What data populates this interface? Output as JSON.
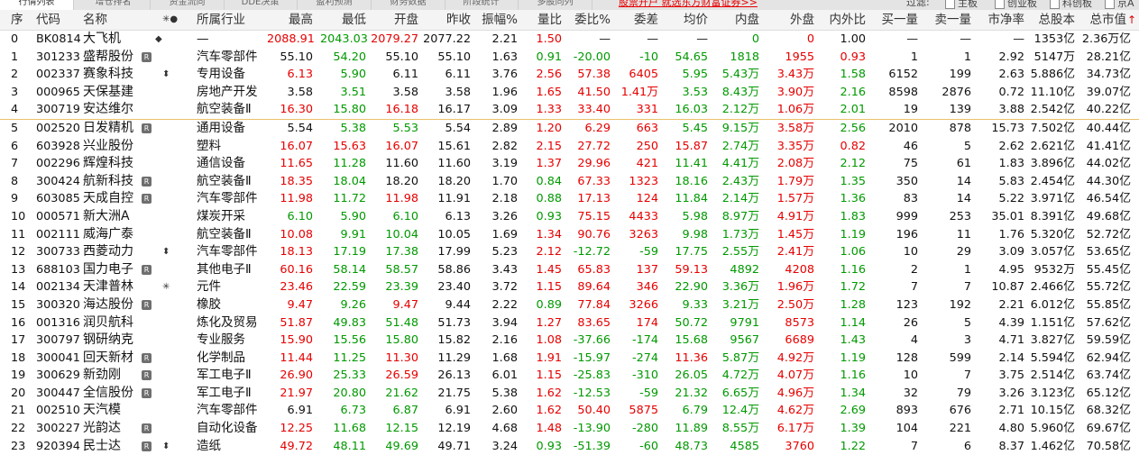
{
  "top_tabs": [
    "行情列表",
    "增仓排名",
    "资金流向",
    "DDE决策",
    "盈利预测",
    "财务数据",
    "阶段统计",
    "多股同列"
  ],
  "promo_link": "股票开户 就选东方财富证券>>",
  "filter": {
    "label": "过滤:",
    "options": [
      {
        "label": "主板",
        "checked": false
      },
      {
        "label": "创业板",
        "checked": false
      },
      {
        "label": "科创板",
        "checked": false
      },
      {
        "label": "京A",
        "checked": false
      }
    ]
  },
  "header": {
    "seq": "序",
    "code": "代码",
    "name": "名称",
    "flags": "✳●",
    "industry": "所属行业",
    "high": "最高",
    "low": "最低",
    "open": "开盘",
    "prev_close": "昨收",
    "amplitude": "振幅%",
    "vol_ratio": "量比",
    "bid_ratio": "委比%",
    "bid_diff": "委差",
    "avg": "均价",
    "inner": "内盘",
    "outer": "外盘",
    "io_ratio": "内外比",
    "buy_vol": "买一量",
    "sell_vol": "卖一量",
    "pb": "市净率",
    "total_shares": "总股本",
    "total_mv": "总市值",
    "sort_indicator": "↑"
  },
  "colors": {
    "up": "#e60000",
    "down": "#009900",
    "neutral": "#111111"
  },
  "rows": [
    {
      "seq": "0",
      "code": "BK0814",
      "name": "大飞机",
      "badge": "",
      "mark": "◆",
      "industry": "—",
      "high": "2088.91",
      "low": "2043.03",
      "open": "2079.27",
      "prev": "2077.22",
      "amp": "2.21",
      "vr": "1.50",
      "br": "—",
      "bd": "—",
      "avg": "—",
      "inner": "0",
      "outer": "0",
      "io": "1.00",
      "buy": "—",
      "sell": "—",
      "pb": "—",
      "shares": "1353亿",
      "mv": "2.36万亿",
      "c": {
        "high": "up",
        "low": "dn",
        "open": "up",
        "vr": "up",
        "inner": "dn",
        "outer": "up",
        "avg": "eq",
        "br": "eq",
        "bd": "eq"
      }
    },
    {
      "seq": "1",
      "code": "301233",
      "name": "盛帮股份",
      "badge": "R",
      "mark": "",
      "industry": "汽车零部件",
      "high": "55.10",
      "low": "54.20",
      "open": "55.10",
      "prev": "55.10",
      "amp": "1.63",
      "vr": "0.91",
      "br": "-20.00",
      "bd": "-10",
      "avg": "54.65",
      "inner": "1818",
      "outer": "1955",
      "io": "0.93",
      "buy": "1",
      "sell": "1",
      "pb": "2.92",
      "shares": "5147万",
      "mv": "28.21亿",
      "c": {
        "high": "eq",
        "low": "dn",
        "open": "eq",
        "vr": "dn",
        "br": "dn",
        "bd": "dn",
        "avg": "dn",
        "inner": "dn",
        "outer": "up",
        "io": "up"
      }
    },
    {
      "seq": "2",
      "code": "002337",
      "name": "赛象科技",
      "badge": "",
      "mark": "⬍",
      "industry": "专用设备",
      "high": "6.13",
      "low": "5.90",
      "open": "6.11",
      "prev": "6.11",
      "amp": "3.76",
      "vr": "2.56",
      "br": "57.38",
      "bd": "6405",
      "avg": "5.95",
      "inner": "5.43万",
      "outer": "3.43万",
      "io": "1.58",
      "buy": "6152",
      "sell": "199",
      "pb": "2.63",
      "shares": "5.886亿",
      "mv": "34.73亿",
      "c": {
        "high": "up",
        "low": "dn",
        "open": "eq",
        "vr": "up",
        "br": "up",
        "bd": "up",
        "avg": "dn",
        "inner": "dn",
        "outer": "up",
        "io": "dn"
      }
    },
    {
      "seq": "3",
      "code": "000965",
      "name": "天保基建",
      "badge": "",
      "mark": "",
      "industry": "房地产开发",
      "high": "3.58",
      "low": "3.51",
      "open": "3.58",
      "prev": "3.58",
      "amp": "1.96",
      "vr": "1.65",
      "br": "41.50",
      "bd": "1.41万",
      "avg": "3.53",
      "inner": "8.43万",
      "outer": "3.90万",
      "io": "2.16",
      "buy": "8598",
      "sell": "2876",
      "pb": "0.72",
      "shares": "11.10亿",
      "mv": "39.07亿",
      "c": {
        "high": "eq",
        "low": "dn",
        "open": "eq",
        "vr": "up",
        "br": "up",
        "bd": "up",
        "avg": "dn",
        "inner": "dn",
        "outer": "up",
        "io": "dn"
      }
    },
    {
      "seq": "4",
      "code": "300719",
      "name": "安达维尔",
      "badge": "",
      "mark": "",
      "industry": "航空装备Ⅱ",
      "high": "16.30",
      "low": "15.80",
      "open": "16.18",
      "prev": "16.17",
      "amp": "3.09",
      "vr": "1.33",
      "br": "33.40",
      "bd": "331",
      "avg": "16.03",
      "inner": "2.12万",
      "outer": "1.06万",
      "io": "2.01",
      "buy": "19",
      "sell": "139",
      "pb": "3.88",
      "shares": "2.542亿",
      "mv": "40.22亿",
      "c": {
        "high": "up",
        "low": "dn",
        "open": "up",
        "vr": "up",
        "br": "up",
        "bd": "up",
        "avg": "dn",
        "inner": "dn",
        "outer": "up",
        "io": "dn"
      }
    },
    {
      "seq": "5",
      "code": "002520",
      "name": "日发精机",
      "badge": "R",
      "mark": "",
      "industry": "通用设备",
      "high": "5.54",
      "low": "5.38",
      "open": "5.53",
      "prev": "5.54",
      "amp": "2.89",
      "vr": "1.20",
      "br": "6.29",
      "bd": "663",
      "avg": "5.45",
      "inner": "9.15万",
      "outer": "3.58万",
      "io": "2.56",
      "buy": "2010",
      "sell": "878",
      "pb": "15.73",
      "shares": "7.502亿",
      "mv": "40.44亿",
      "c": {
        "high": "eq",
        "low": "dn",
        "open": "dn",
        "vr": "up",
        "br": "up",
        "bd": "up",
        "avg": "dn",
        "inner": "dn",
        "outer": "up",
        "io": "dn"
      }
    },
    {
      "seq": "6",
      "code": "603928",
      "name": "兴业股份",
      "badge": "",
      "mark": "",
      "industry": "塑料",
      "high": "16.07",
      "low": "15.63",
      "open": "16.07",
      "prev": "15.61",
      "amp": "2.82",
      "vr": "2.15",
      "br": "27.72",
      "bd": "250",
      "avg": "15.87",
      "inner": "2.74万",
      "outer": "3.35万",
      "io": "0.82",
      "buy": "46",
      "sell": "5",
      "pb": "2.62",
      "shares": "2.621亿",
      "mv": "41.41亿",
      "c": {
        "high": "up",
        "low": "up",
        "open": "up",
        "vr": "up",
        "br": "up",
        "bd": "up",
        "avg": "up",
        "inner": "dn",
        "outer": "up",
        "io": "up"
      }
    },
    {
      "seq": "7",
      "code": "002296",
      "name": "辉煌科技",
      "badge": "",
      "mark": "",
      "industry": "通信设备",
      "high": "11.65",
      "low": "11.28",
      "open": "11.60",
      "prev": "11.60",
      "amp": "3.19",
      "vr": "1.37",
      "br": "29.96",
      "bd": "421",
      "avg": "11.41",
      "inner": "4.41万",
      "outer": "2.08万",
      "io": "2.12",
      "buy": "75",
      "sell": "61",
      "pb": "1.83",
      "shares": "3.896亿",
      "mv": "44.02亿",
      "c": {
        "high": "up",
        "low": "dn",
        "open": "eq",
        "vr": "up",
        "br": "up",
        "bd": "up",
        "avg": "dn",
        "inner": "dn",
        "outer": "up",
        "io": "dn"
      }
    },
    {
      "seq": "8",
      "code": "300424",
      "name": "航新科技",
      "badge": "R",
      "mark": "",
      "industry": "航空装备Ⅱ",
      "high": "18.35",
      "low": "18.04",
      "open": "18.20",
      "prev": "18.20",
      "amp": "1.70",
      "vr": "0.84",
      "br": "67.33",
      "bd": "1323",
      "avg": "18.16",
      "inner": "2.43万",
      "outer": "1.79万",
      "io": "1.35",
      "buy": "350",
      "sell": "14",
      "pb": "5.83",
      "shares": "2.454亿",
      "mv": "44.30亿",
      "c": {
        "high": "up",
        "low": "dn",
        "open": "eq",
        "vr": "dn",
        "br": "up",
        "bd": "up",
        "avg": "dn",
        "inner": "dn",
        "outer": "up",
        "io": "dn"
      }
    },
    {
      "seq": "9",
      "code": "603085",
      "name": "天成自控",
      "badge": "R",
      "mark": "",
      "industry": "汽车零部件",
      "high": "11.98",
      "low": "11.72",
      "open": "11.98",
      "prev": "11.91",
      "amp": "2.18",
      "vr": "0.88",
      "br": "17.13",
      "bd": "124",
      "avg": "11.84",
      "inner": "2.14万",
      "outer": "1.57万",
      "io": "1.36",
      "buy": "83",
      "sell": "14",
      "pb": "5.22",
      "shares": "3.971亿",
      "mv": "46.54亿",
      "c": {
        "high": "up",
        "low": "dn",
        "open": "up",
        "vr": "dn",
        "br": "up",
        "bd": "up",
        "avg": "dn",
        "inner": "dn",
        "outer": "up",
        "io": "dn"
      }
    },
    {
      "seq": "10",
      "code": "000571",
      "name": "新大洲A",
      "badge": "",
      "mark": "",
      "industry": "煤炭开采",
      "high": "6.10",
      "low": "5.90",
      "open": "6.10",
      "prev": "6.13",
      "amp": "3.26",
      "vr": "0.93",
      "br": "75.15",
      "bd": "4433",
      "avg": "5.98",
      "inner": "8.97万",
      "outer": "4.91万",
      "io": "1.83",
      "buy": "999",
      "sell": "253",
      "pb": "35.01",
      "shares": "8.391亿",
      "mv": "49.68亿",
      "c": {
        "high": "dn",
        "low": "dn",
        "open": "dn",
        "vr": "dn",
        "br": "up",
        "bd": "up",
        "avg": "dn",
        "inner": "dn",
        "outer": "up",
        "io": "dn"
      }
    },
    {
      "seq": "11",
      "code": "002111",
      "name": "威海广泰",
      "badge": "",
      "mark": "",
      "industry": "航空装备Ⅱ",
      "high": "10.08",
      "low": "9.91",
      "open": "10.04",
      "prev": "10.05",
      "amp": "1.69",
      "vr": "1.34",
      "br": "90.76",
      "bd": "3263",
      "avg": "9.98",
      "inner": "1.73万",
      "outer": "1.45万",
      "io": "1.19",
      "buy": "196",
      "sell": "11",
      "pb": "1.76",
      "shares": "5.320亿",
      "mv": "52.72亿",
      "c": {
        "high": "up",
        "low": "dn",
        "open": "dn",
        "vr": "up",
        "br": "up",
        "bd": "up",
        "avg": "dn",
        "inner": "dn",
        "outer": "up",
        "io": "dn"
      }
    },
    {
      "seq": "12",
      "code": "300733",
      "name": "西菱动力",
      "badge": "",
      "mark": "⬍",
      "industry": "汽车零部件",
      "high": "18.13",
      "low": "17.19",
      "open": "17.38",
      "prev": "17.99",
      "amp": "5.23",
      "vr": "2.12",
      "br": "-12.72",
      "bd": "-59",
      "avg": "17.75",
      "inner": "2.55万",
      "outer": "2.41万",
      "io": "1.06",
      "buy": "10",
      "sell": "29",
      "pb": "3.09",
      "shares": "3.057亿",
      "mv": "53.65亿",
      "c": {
        "high": "up",
        "low": "dn",
        "open": "dn",
        "vr": "up",
        "br": "dn",
        "bd": "dn",
        "avg": "dn",
        "inner": "dn",
        "outer": "up",
        "io": "dn"
      }
    },
    {
      "seq": "13",
      "code": "688103",
      "name": "国力电子",
      "badge": "R",
      "mark": "",
      "industry": "其他电子Ⅱ",
      "high": "60.16",
      "low": "58.14",
      "open": "58.57",
      "prev": "58.86",
      "amp": "3.43",
      "vr": "1.45",
      "br": "65.83",
      "bd": "137",
      "avg": "59.13",
      "inner": "4892",
      "outer": "4208",
      "io": "1.16",
      "buy": "2",
      "sell": "1",
      "pb": "4.95",
      "shares": "9532万",
      "mv": "55.45亿",
      "c": {
        "high": "up",
        "low": "dn",
        "open": "dn",
        "vr": "up",
        "br": "up",
        "bd": "up",
        "avg": "up",
        "inner": "dn",
        "outer": "up",
        "io": "dn"
      }
    },
    {
      "seq": "14",
      "code": "002134",
      "name": "天津普林",
      "badge": "",
      "mark": "✳",
      "industry": "元件",
      "high": "23.46",
      "low": "22.59",
      "open": "23.39",
      "prev": "23.40",
      "amp": "3.72",
      "vr": "1.15",
      "br": "89.64",
      "bd": "346",
      "avg": "22.90",
      "inner": "3.36万",
      "outer": "1.96万",
      "io": "1.72",
      "buy": "7",
      "sell": "7",
      "pb": "10.87",
      "shares": "2.466亿",
      "mv": "55.72亿",
      "c": {
        "high": "up",
        "low": "dn",
        "open": "dn",
        "vr": "up",
        "br": "up",
        "bd": "up",
        "avg": "dn",
        "inner": "dn",
        "outer": "up",
        "io": "dn"
      }
    },
    {
      "seq": "15",
      "code": "300320",
      "name": "海达股份",
      "badge": "R",
      "mark": "",
      "industry": "橡胶",
      "high": "9.47",
      "low": "9.26",
      "open": "9.47",
      "prev": "9.44",
      "amp": "2.22",
      "vr": "0.89",
      "br": "77.84",
      "bd": "3266",
      "avg": "9.33",
      "inner": "3.21万",
      "outer": "2.50万",
      "io": "1.28",
      "buy": "123",
      "sell": "192",
      "pb": "2.21",
      "shares": "6.012亿",
      "mv": "55.85亿",
      "c": {
        "high": "up",
        "low": "dn",
        "open": "up",
        "vr": "dn",
        "br": "up",
        "bd": "up",
        "avg": "dn",
        "inner": "dn",
        "outer": "up",
        "io": "dn"
      }
    },
    {
      "seq": "16",
      "code": "001316",
      "name": "润贝航科",
      "badge": "",
      "mark": "",
      "industry": "炼化及贸易",
      "high": "51.87",
      "low": "49.83",
      "open": "51.48",
      "prev": "51.73",
      "amp": "3.94",
      "vr": "1.27",
      "br": "83.65",
      "bd": "174",
      "avg": "50.72",
      "inner": "9791",
      "outer": "8573",
      "io": "1.14",
      "buy": "26",
      "sell": "5",
      "pb": "4.39",
      "shares": "1.151亿",
      "mv": "57.62亿",
      "c": {
        "high": "up",
        "low": "dn",
        "open": "dn",
        "vr": "up",
        "br": "up",
        "bd": "up",
        "avg": "dn",
        "inner": "dn",
        "outer": "up",
        "io": "dn"
      }
    },
    {
      "seq": "17",
      "code": "300797",
      "name": "钢研纳克",
      "badge": "",
      "mark": "",
      "industry": "专业服务",
      "high": "15.90",
      "low": "15.56",
      "open": "15.80",
      "prev": "15.82",
      "amp": "2.16",
      "vr": "1.08",
      "br": "-37.66",
      "bd": "-174",
      "avg": "15.68",
      "inner": "9567",
      "outer": "6689",
      "io": "1.43",
      "buy": "4",
      "sell": "3",
      "pb": "4.71",
      "shares": "3.827亿",
      "mv": "59.59亿",
      "c": {
        "high": "up",
        "low": "dn",
        "open": "dn",
        "vr": "up",
        "br": "dn",
        "bd": "dn",
        "avg": "dn",
        "inner": "dn",
        "outer": "up",
        "io": "dn"
      }
    },
    {
      "seq": "18",
      "code": "300041",
      "name": "回天新材",
      "badge": "R",
      "mark": "",
      "industry": "化学制品",
      "high": "11.44",
      "low": "11.25",
      "open": "11.30",
      "prev": "11.29",
      "amp": "1.68",
      "vr": "1.91",
      "br": "-15.97",
      "bd": "-274",
      "avg": "11.36",
      "inner": "5.87万",
      "outer": "4.92万",
      "io": "1.19",
      "buy": "128",
      "sell": "599",
      "pb": "2.14",
      "shares": "5.594亿",
      "mv": "62.94亿",
      "c": {
        "high": "up",
        "low": "dn",
        "open": "up",
        "vr": "up",
        "br": "dn",
        "bd": "dn",
        "avg": "up",
        "inner": "dn",
        "outer": "up",
        "io": "dn"
      }
    },
    {
      "seq": "19",
      "code": "300629",
      "name": "新劲刚",
      "badge": "R",
      "mark": "",
      "industry": "军工电子Ⅱ",
      "high": "26.90",
      "low": "25.33",
      "open": "26.59",
      "prev": "26.13",
      "amp": "6.01",
      "vr": "1.15",
      "br": "-25.83",
      "bd": "-310",
      "avg": "26.05",
      "inner": "4.72万",
      "outer": "4.07万",
      "io": "1.16",
      "buy": "10",
      "sell": "7",
      "pb": "3.75",
      "shares": "2.514亿",
      "mv": "63.74亿",
      "c": {
        "high": "up",
        "low": "dn",
        "open": "up",
        "vr": "up",
        "br": "dn",
        "bd": "dn",
        "avg": "dn",
        "inner": "dn",
        "outer": "up",
        "io": "dn"
      }
    },
    {
      "seq": "20",
      "code": "300447",
      "name": "全信股份",
      "badge": "R",
      "mark": "",
      "industry": "军工电子Ⅱ",
      "high": "21.97",
      "low": "20.80",
      "open": "21.62",
      "prev": "21.75",
      "amp": "5.38",
      "vr": "1.62",
      "br": "-12.53",
      "bd": "-59",
      "avg": "21.32",
      "inner": "6.65万",
      "outer": "4.96万",
      "io": "1.34",
      "buy": "32",
      "sell": "79",
      "pb": "3.26",
      "shares": "3.123亿",
      "mv": "65.12亿",
      "c": {
        "high": "up",
        "low": "dn",
        "open": "dn",
        "vr": "up",
        "br": "dn",
        "bd": "dn",
        "avg": "dn",
        "inner": "dn",
        "outer": "up",
        "io": "dn"
      }
    },
    {
      "seq": "21",
      "code": "002510",
      "name": "天汽模",
      "badge": "",
      "mark": "",
      "industry": "汽车零部件",
      "high": "6.91",
      "low": "6.73",
      "open": "6.87",
      "prev": "6.91",
      "amp": "2.60",
      "vr": "1.62",
      "br": "50.40",
      "bd": "5875",
      "avg": "6.79",
      "inner": "12.4万",
      "outer": "4.62万",
      "io": "2.69",
      "buy": "893",
      "sell": "676",
      "pb": "2.71",
      "shares": "10.15亿",
      "mv": "68.32亿",
      "c": {
        "high": "eq",
        "low": "dn",
        "open": "dn",
        "vr": "up",
        "br": "up",
        "bd": "up",
        "avg": "dn",
        "inner": "dn",
        "outer": "up",
        "io": "dn"
      }
    },
    {
      "seq": "22",
      "code": "300227",
      "name": "光韵达",
      "badge": "R",
      "mark": "",
      "industry": "自动化设备",
      "high": "12.25",
      "low": "11.68",
      "open": "12.15",
      "prev": "12.19",
      "amp": "4.68",
      "vr": "1.48",
      "br": "-13.90",
      "bd": "-280",
      "avg": "11.89",
      "inner": "8.55万",
      "outer": "6.17万",
      "io": "1.39",
      "buy": "104",
      "sell": "221",
      "pb": "4.80",
      "shares": "5.960亿",
      "mv": "69.67亿",
      "c": {
        "high": "up",
        "low": "dn",
        "open": "dn",
        "vr": "up",
        "br": "dn",
        "bd": "dn",
        "avg": "dn",
        "inner": "dn",
        "outer": "up",
        "io": "dn"
      }
    },
    {
      "seq": "23",
      "code": "920394",
      "name": "民士达",
      "badge": "R",
      "mark": "⬍",
      "industry": "造纸",
      "high": "49.72",
      "low": "48.11",
      "open": "49.69",
      "prev": "49.71",
      "amp": "3.24",
      "vr": "0.93",
      "br": "-51.39",
      "bd": "-60",
      "avg": "48.73",
      "inner": "4585",
      "outer": "3760",
      "io": "1.22",
      "buy": "7",
      "sell": "6",
      "pb": "8.37",
      "shares": "1.462亿",
      "mv": "70.58亿",
      "c": {
        "high": "up",
        "low": "dn",
        "open": "dn",
        "vr": "dn",
        "br": "dn",
        "bd": "dn",
        "avg": "dn",
        "inner": "dn",
        "outer": "up",
        "io": "dn"
      }
    }
  ]
}
